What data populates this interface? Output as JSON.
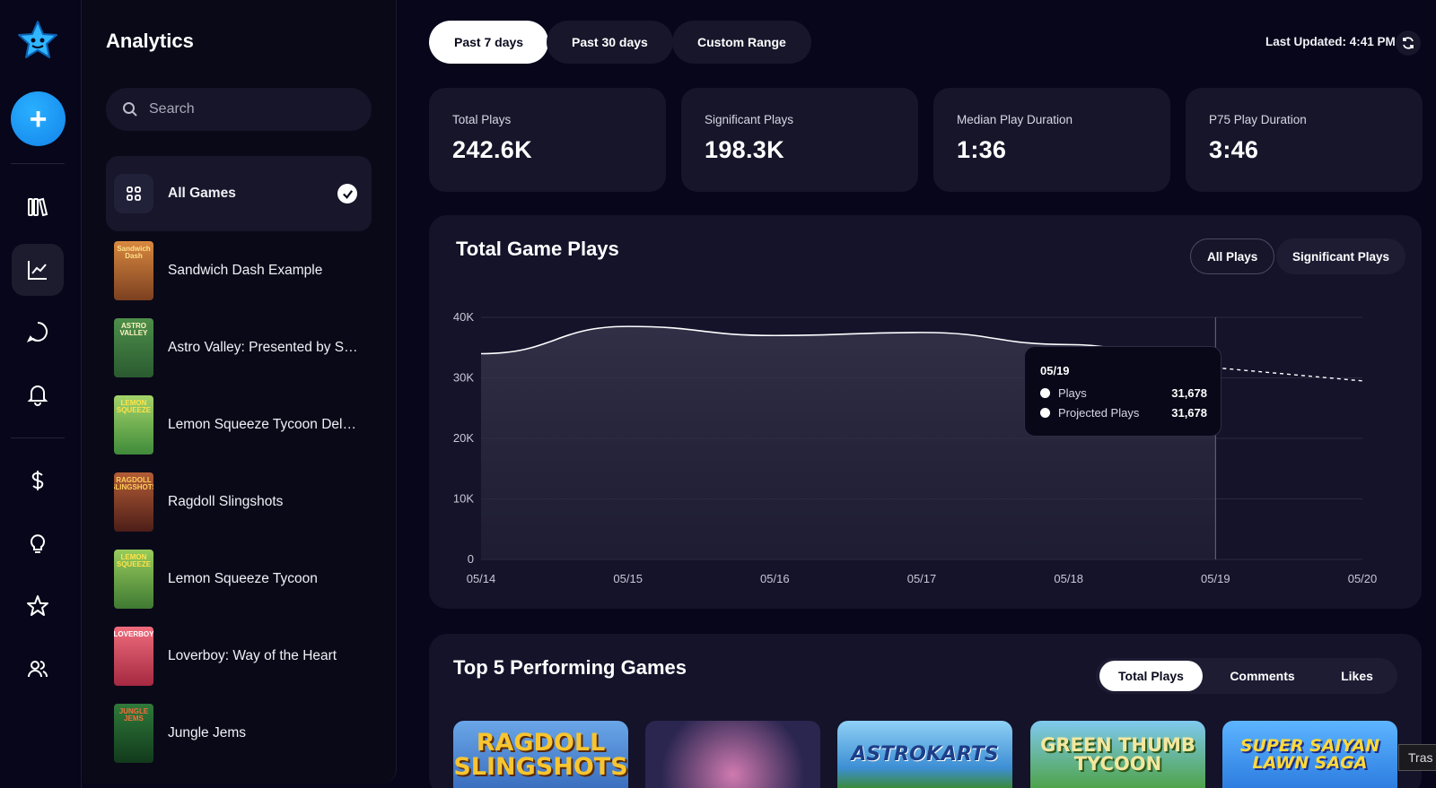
{
  "sidebar": {
    "title": "Analytics",
    "search_placeholder": "Search",
    "games": [
      {
        "name": "All Games",
        "thumb_text": "",
        "color": "#22213a",
        "selected": true
      },
      {
        "name": "Sandwich Dash Example",
        "thumb_text": "Sandwich Dash",
        "color": "#b8652a"
      },
      {
        "name": "Astro Valley: Presented by Se...",
        "thumb_text": "ASTRO VALLEY",
        "color": "#3d7a3a"
      },
      {
        "name": "Lemon Squeeze Tycoon Delu...",
        "thumb_text": "LEMON SQUEEZE",
        "color": "#7bb548"
      },
      {
        "name": "Ragdoll Slingshots",
        "thumb_text": "RAGDOLL SLINGSHOTS",
        "color": "#8a3a2a"
      },
      {
        "name": "Lemon Squeeze Tycoon",
        "thumb_text": "LEMON SQUEEZE",
        "color": "#6fae3f"
      },
      {
        "name": "Loverboy: Way of the Heart",
        "thumb_text": "LOVERBOY",
        "color": "#d8435e"
      },
      {
        "name": "Jungle Jems",
        "thumb_text": "JUNGLE JEMS",
        "color": "#1f4f2a"
      }
    ]
  },
  "rail": {
    "icons": [
      "library-icon",
      "analytics-icon",
      "chat-icon",
      "bell-icon",
      "dollar-icon",
      "lightbulb-icon",
      "star-icon",
      "users-icon"
    ],
    "active": "analytics-icon"
  },
  "header": {
    "ranges": [
      "Past 7 days",
      "Past 30 days",
      "Custom Range"
    ],
    "active_range": "Past 7 days",
    "last_updated": "Last Updated: 4:41 PM"
  },
  "stats": [
    {
      "label": "Total Plays",
      "value": "242.6K"
    },
    {
      "label": "Significant Plays",
      "value": "198.3K"
    },
    {
      "label": "Median Play Duration",
      "value": "1:36"
    },
    {
      "label": "P75 Play Duration",
      "value": "3:46"
    }
  ],
  "plays_panel": {
    "title": "Total Game Plays",
    "toggles": [
      "All Plays",
      "Significant Plays"
    ],
    "active_toggle": "All Plays"
  },
  "chart_data": {
    "type": "area",
    "title": "Total Game Plays",
    "x": [
      "05/14",
      "05/15",
      "05/16",
      "05/17",
      "05/18",
      "05/19",
      "05/20"
    ],
    "yticks": [
      "0",
      "10K",
      "20K",
      "30K",
      "40K"
    ],
    "ylim": [
      0,
      40000
    ],
    "series": [
      {
        "name": "Plays",
        "values": [
          34000,
          38500,
          37000,
          37500,
          35500,
          31678,
          null
        ]
      },
      {
        "name": "Projected Plays",
        "values": [
          null,
          null,
          null,
          null,
          null,
          31678,
          29500
        ]
      }
    ],
    "grid": true,
    "tooltip": {
      "date": "05/19",
      "rows": [
        {
          "label": "Plays",
          "value": "31,678"
        },
        {
          "label": "Projected Plays",
          "value": "31,678"
        }
      ]
    }
  },
  "top_panel": {
    "title": "Top 5 Performing Games",
    "tabs": [
      "Total Plays",
      "Comments",
      "Likes"
    ],
    "active_tab": "Total Plays",
    "posters": [
      {
        "text": "RAGDOLL SLINGSHOTS",
        "bg": "#3a6fbf",
        "fg": "#f7c531"
      },
      {
        "text": "",
        "bg": "#2a2650",
        "fg": "#d07ab0"
      },
      {
        "text": "ASTROKARTS",
        "bg": "#58a6de",
        "fg": "#1d3f8a"
      },
      {
        "text": "GREEN THUMB TYCOON",
        "bg": "#4fa34a",
        "fg": "#f3e7a0"
      },
      {
        "text": "SUPER SAIYAN LAWN SAGA",
        "bg": "#2d7de0",
        "fg": "#ffd93a"
      }
    ]
  },
  "tooltip_text": "Tras"
}
